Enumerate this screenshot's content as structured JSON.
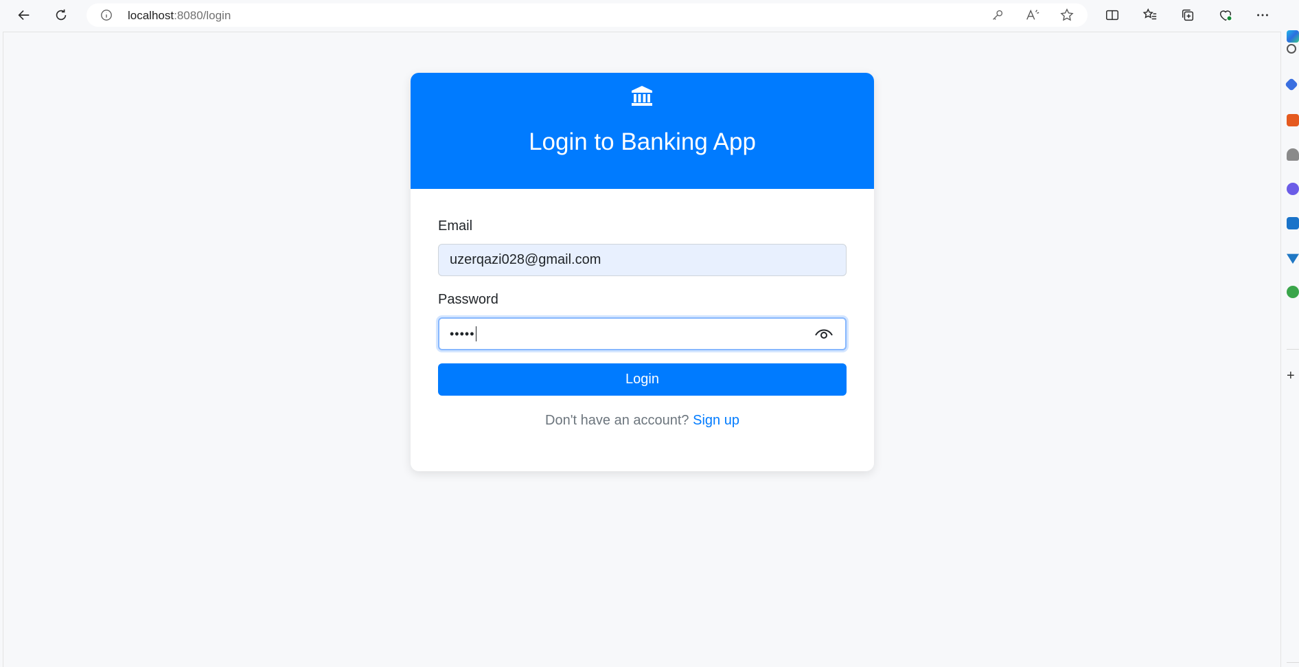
{
  "browser": {
    "url_host": "localhost",
    "url_path": ":8080/login",
    "icons": [
      "back-icon",
      "refresh-icon",
      "info-icon",
      "key-icon",
      "read-aloud-icon",
      "favorite-star-icon",
      "split-screen-icon",
      "favorites-icon",
      "collections-icon",
      "browser-essentials-icon",
      "more-icon"
    ]
  },
  "login": {
    "title": "Login to Banking App",
    "email_label": "Email",
    "email_value": "uzerqazi028@gmail.com",
    "password_label": "Password",
    "password_value": "•••••",
    "login_button": "Login",
    "signup_prompt": "Don't have an account? ",
    "signup_link": "Sign up"
  },
  "colors": {
    "primary": "#007bff",
    "autofill_bg": "#e8f0fe",
    "page_bg": "#f7f8fa"
  }
}
